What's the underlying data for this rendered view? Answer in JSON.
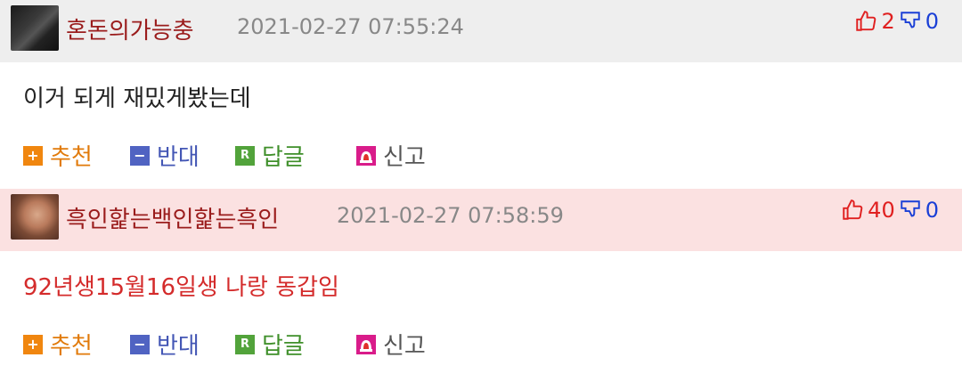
{
  "comments": [
    {
      "nickname": "혼돈의가능충",
      "datetime": "2021-02-27 07:55:24",
      "upvotes": "2",
      "downvotes": "0",
      "text": "이거 되게 재밌게봤는데",
      "actions": {
        "recommend": "추천",
        "oppose": "반대",
        "reply": "답글",
        "report": "신고"
      }
    },
    {
      "nickname": "흑인핥는백인핥는흑인",
      "datetime": "2021-02-27 07:58:59",
      "upvotes": "40",
      "downvotes": "0",
      "text": "92년생15월16일생 나랑 동갑임",
      "actions": {
        "recommend": "추천",
        "oppose": "반대",
        "reply": "답글",
        "report": "신고"
      }
    }
  ],
  "icons": {
    "recommend": "plus-icon",
    "oppose": "minus-icon",
    "reply": "reply-r-icon",
    "report": "siren-icon",
    "upvote": "thumbs-up-icon",
    "downvote": "thumbs-down-icon"
  },
  "colors": {
    "header_normal": "#eeeeee",
    "header_highlight": "#fbe1e1",
    "nickname": "#9a1c1c",
    "upvote": "#e02020",
    "downvote": "#1a3fd6",
    "best_comment_text": "#d42b2b"
  }
}
